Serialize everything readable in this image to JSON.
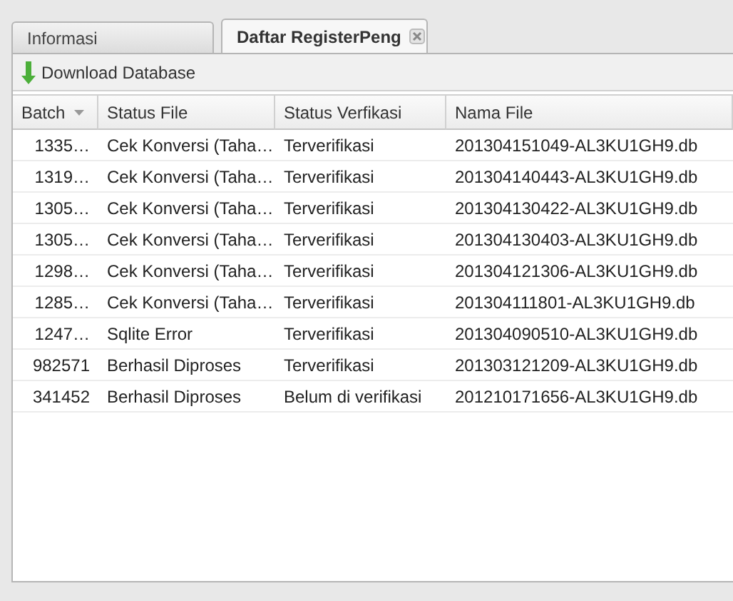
{
  "tabs": [
    {
      "label": "Informasi",
      "selected": false,
      "closable": false
    },
    {
      "label": "Daftar RegisterPeng",
      "selected": true,
      "closable": true
    }
  ],
  "toolbar": {
    "button": "Download Database"
  },
  "table": {
    "columns": [
      {
        "label": "Batch",
        "sorted": true
      },
      {
        "label": "Status File",
        "sorted": false
      },
      {
        "label": "Status Verfikasi",
        "sorted": false
      },
      {
        "label": "Nama File",
        "sorted": false
      }
    ],
    "rows": [
      [
        "1335…",
        "Cek Konversi (Taha…",
        "Terverifikasi",
        "201304151049-AL3KU1GH9.db"
      ],
      [
        "1319…",
        "Cek Konversi (Taha…",
        "Terverifikasi",
        "201304140443-AL3KU1GH9.db"
      ],
      [
        "1305…",
        "Cek Konversi (Taha…",
        "Terverifikasi",
        "201304130422-AL3KU1GH9.db"
      ],
      [
        "1305…",
        "Cek Konversi (Taha…",
        "Terverifikasi",
        "201304130403-AL3KU1GH9.db"
      ],
      [
        "1298…",
        "Cek Konversi (Taha…",
        "Terverifikasi",
        "201304121306-AL3KU1GH9.db"
      ],
      [
        "1285…",
        "Cek Konversi (Taha…",
        "Terverifikasi",
        "201304111801-AL3KU1GH9.db"
      ],
      [
        "1247…",
        "Sqlite Error",
        "Terverifikasi",
        "201304090510-AL3KU1GH9.db"
      ],
      [
        "982571",
        "Berhasil Diproses",
        "Terverifikasi",
        "201303121209-AL3KU1GH9.db"
      ],
      [
        "341452",
        "Berhasil Diproses",
        "Belum di verifikasi",
        "201210171656-AL3KU1GH9.db"
      ]
    ]
  }
}
